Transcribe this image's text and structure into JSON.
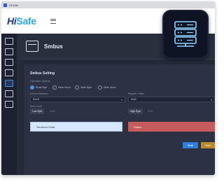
{
  "window": {
    "title": "Hi Safe"
  },
  "brand": {
    "hi": "Hi",
    "safe": "Safe"
  },
  "page": {
    "title": "Smbus"
  },
  "card": {
    "title": "Smbus Setting",
    "operation_label": "Operation Options",
    "radios": [
      {
        "label": "Read Byte",
        "selected": true
      },
      {
        "label": "Read Word",
        "selected": false
      },
      {
        "label": "Write Byte",
        "selected": false
      },
      {
        "label": "Write Word",
        "selected": false
      }
    ],
    "left_select_label": "Device Selection",
    "left_select_value": "SoUS",
    "right_select_label": "Register Offset",
    "right_select_value": "0x00",
    "slave_label": "Slave Addr",
    "low_byte_label": "Low Byte",
    "low_byte_value": "0x00",
    "high_byte_label": "High Byte",
    "high_byte_value": "0x00",
    "received_label": "Received Data",
    "status_label": "Status",
    "read_label": "Read",
    "write_label": "Write"
  },
  "colors": {
    "accent": "#2e7fd6",
    "status": "#c75a5a",
    "write": "#b88a2c"
  }
}
